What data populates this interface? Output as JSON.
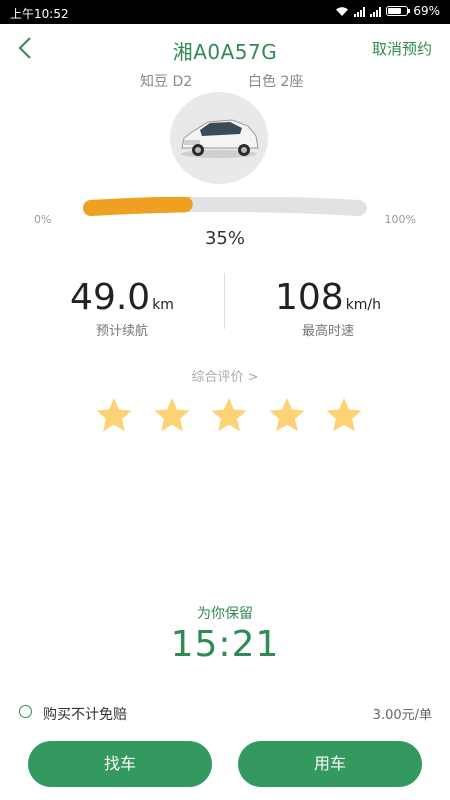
{
  "status_bar": {
    "time": "上午10:52",
    "battery_percent_text": "69%",
    "battery_level": 0.69,
    "icons": [
      "wifi-icon",
      "signal-icon",
      "signal-icon",
      "battery-icon"
    ]
  },
  "header": {
    "back_icon": "chevron-left-icon",
    "plate": "湘A0A57G",
    "cancel_label": "取消预约"
  },
  "car": {
    "model": "知豆 D2",
    "color_seats": "白色 2座",
    "photo": "car-photo"
  },
  "battery": {
    "min_label": "0%",
    "max_label": "100%",
    "level": 0.35,
    "percent_text": "35%"
  },
  "stats": {
    "range_value": "49.0",
    "range_unit": "km",
    "range_label": "预计续航",
    "speed_value": "108",
    "speed_unit": "km/h",
    "speed_label": "最高时速"
  },
  "rating": {
    "link_label": "综合评价 >",
    "stars": 5,
    "max_stars": 5
  },
  "reservation": {
    "label": "为你保留",
    "countdown": "15:21"
  },
  "insurance": {
    "label": "购买不计免赔",
    "price": "3.00元/单",
    "checked": false
  },
  "actions": {
    "find_car": "找车",
    "use_car": "用车"
  },
  "colors": {
    "brand_green": "#2f8a54",
    "button_green": "#33995f",
    "battery_fill": "#f0a020",
    "star": "#fcd374"
  }
}
